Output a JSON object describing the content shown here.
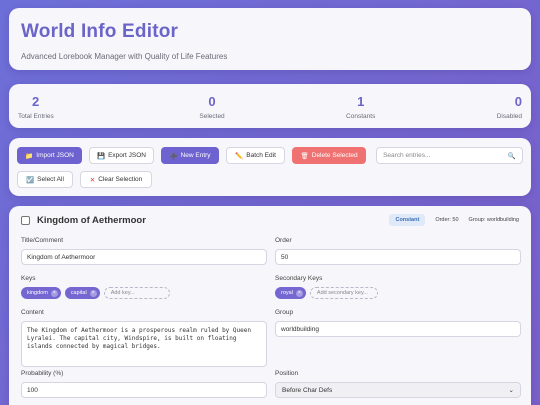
{
  "header": {
    "title": "World Info Editor",
    "subtitle": "Advanced Lorebook Manager with Quality of Life Features"
  },
  "stats": [
    {
      "value": "2",
      "label": "Total Entries"
    },
    {
      "value": "0",
      "label": "Selected"
    },
    {
      "value": "1",
      "label": "Constants"
    },
    {
      "value": "0",
      "label": "Disabled"
    }
  ],
  "toolbar": {
    "import": "Import JSON",
    "export": "Export JSON",
    "new": "New Entry",
    "batch": "Batch Edit",
    "delete": "Delete Selected",
    "search_placeholder": "Search entries...",
    "select_all": "Select All",
    "clear": "Clear Selection"
  },
  "entry": {
    "title": "Kingdom of Aethermoor",
    "badge": "Constant",
    "order_meta": "Order: 50",
    "group_meta": "Group: worldbuilding",
    "fields": {
      "title_label": "Title/Comment",
      "title_value": "Kingdom of Aethermoor",
      "order_label": "Order",
      "order_value": "50",
      "keys_label": "Keys",
      "keys": [
        "kingdom",
        "capital"
      ],
      "add_key": "Add key...",
      "secondary_label": "Secondary Keys",
      "secondary_keys": [
        "royal"
      ],
      "add_secondary": "Add secondary key...",
      "content_label": "Content",
      "content_value": "The Kingdom of Aethermoor is a prosperous realm ruled by Queen Lyralei. The capital city, Windspire, is built on floating islands connected by magical bridges.",
      "group_label": "Group",
      "group_value": "worldbuilding",
      "probability_label": "Probability (%)",
      "probability_value": "100",
      "position_label": "Position",
      "position_value": "Before Char Defs"
    }
  }
}
